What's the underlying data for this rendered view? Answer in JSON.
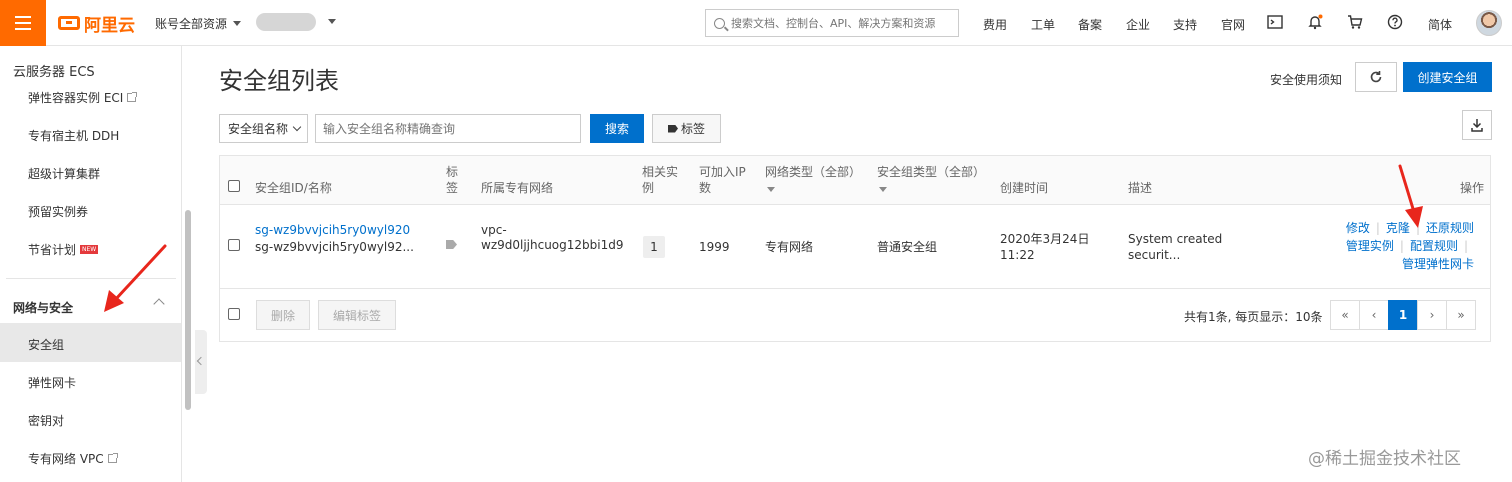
{
  "topbar": {
    "logo_text": "阿里云",
    "account_label": "账号全部资源",
    "search_placeholder": "搜索文档、控制台、API、解决方案和资源",
    "nav": [
      "费用",
      "工单",
      "备案",
      "企业",
      "支持",
      "官网"
    ],
    "lang": "简体"
  },
  "sidebar": {
    "title": "云服务器 ECS",
    "items_top": [
      {
        "label": "弹性容器实例 ECI"
      },
      {
        "label": "专有宿主机 DDH"
      },
      {
        "label": "超级计算集群"
      },
      {
        "label": "预留实例券"
      },
      {
        "label": "节省计划",
        "badge": "NEW"
      }
    ],
    "group_label": "网络与安全",
    "group_items": [
      {
        "label": "安全组",
        "active": true
      },
      {
        "label": "弹性网卡"
      },
      {
        "label": "密钥对"
      },
      {
        "label": "专有网络 VPC"
      }
    ]
  },
  "main": {
    "title": "安全组列表",
    "notice_link": "安全使用须知",
    "create_button": "创建安全组",
    "filter": {
      "select_value": "安全组名称",
      "input_placeholder": "输入安全组名称精确查询",
      "search_button": "搜索",
      "tag_button": "标签"
    },
    "table": {
      "headers": {
        "id_name": "安全组ID/名称",
        "tag_1": "标",
        "tag_2": "签",
        "vpc": "所属专有网络",
        "related_1": "相关实",
        "related_2": "例",
        "available_1": "可加入IP",
        "available_2": "数",
        "network_type": "网络类型（全部）",
        "sg_type": "安全组类型（全部）",
        "created": "创建时间",
        "desc": "描述",
        "ops": "操作"
      },
      "row": {
        "id": "sg-wz9bvvjcih5ry0wyl920",
        "name": "sg-wz9bvvjcih5ry0wyl92...",
        "vpc_1": "vpc-",
        "vpc_2": "wz9d0ljjhcuog12bbi1d9",
        "related": "1",
        "available_ip": "1999",
        "network_type": "专有网络",
        "sg_type": "普通安全组",
        "created_date": "2020年3月24日",
        "created_time": "11:22",
        "desc_1": "System created",
        "desc_2": "securit...",
        "ops": {
          "modify": "修改",
          "clone": "克隆",
          "restore": "还原规则",
          "manage_instances": "管理实例",
          "config_rules": "配置规则",
          "manage_eni": "管理弹性网卡"
        }
      },
      "footer": {
        "delete_button": "删除",
        "edit_tags_button": "编辑标签",
        "page_info": "共有1条, 每页显示：10条",
        "pager": [
          "«",
          "‹",
          "1",
          "›",
          "»"
        ],
        "current_page": "1"
      }
    }
  },
  "watermark": "@稀土掘金技术社区",
  "colors": {
    "brand": "#ff6a00",
    "primary": "#0070cc",
    "annotation": "#e8261c"
  }
}
